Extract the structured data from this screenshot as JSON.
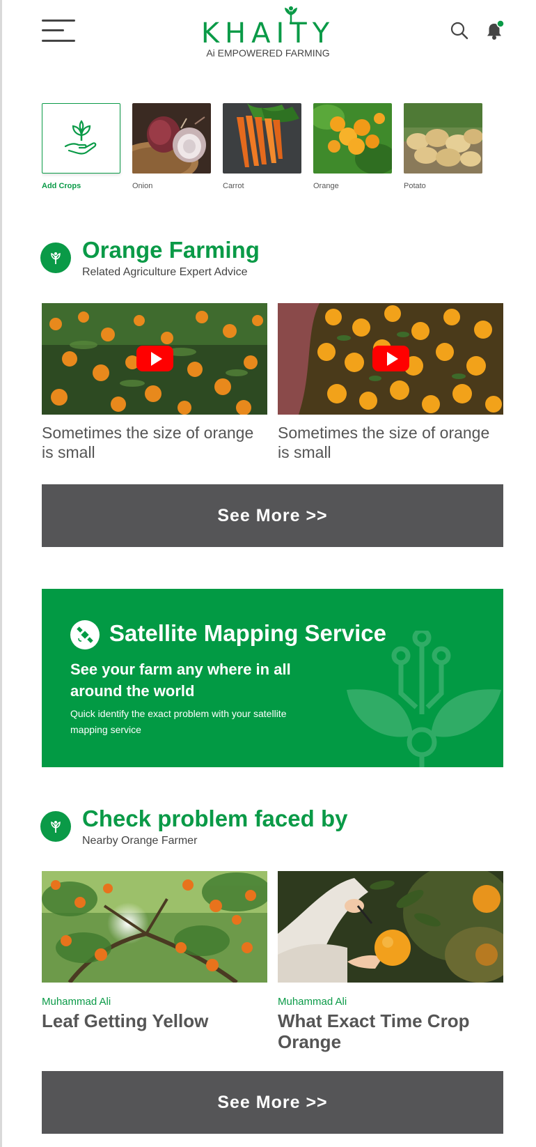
{
  "header": {
    "logo_word": "KHAITY",
    "logo_tagline": "Ai EMPOWERED FARMING"
  },
  "crops": [
    {
      "label": "Add Crops",
      "icon": "plant-hand-icon"
    },
    {
      "label": "Onion"
    },
    {
      "label": "Carrot"
    },
    {
      "label": "Orange"
    },
    {
      "label": "Potato"
    }
  ],
  "section1": {
    "title": "Orange Farming",
    "subtitle": "Related Agriculture Expert Advice",
    "videos": [
      {
        "caption": "Sometimes the size of orange is small"
      },
      {
        "caption": "Sometimes the size of orange is small"
      }
    ],
    "see_more": "See More >>"
  },
  "satellite": {
    "title": "Satellite Mapping Service",
    "subtitle": "See your farm any where in all around the world",
    "description": "Quick identify the exact problem with your satellite mapping service"
  },
  "section2": {
    "title": "Check problem faced by",
    "subtitle": "Nearby Orange Farmer",
    "posts": [
      {
        "author": "Muhammad Ali",
        "title": "Leaf Getting Yellow"
      },
      {
        "author": "Muhammad Ali",
        "title": "What Exact Time Crop Orange"
      }
    ],
    "see_more": "See More >>"
  },
  "colors": {
    "brand_green": "#0a9a47",
    "banner_green": "#029a44",
    "button_gray": "#555557",
    "youtube_red": "#ff0000"
  }
}
